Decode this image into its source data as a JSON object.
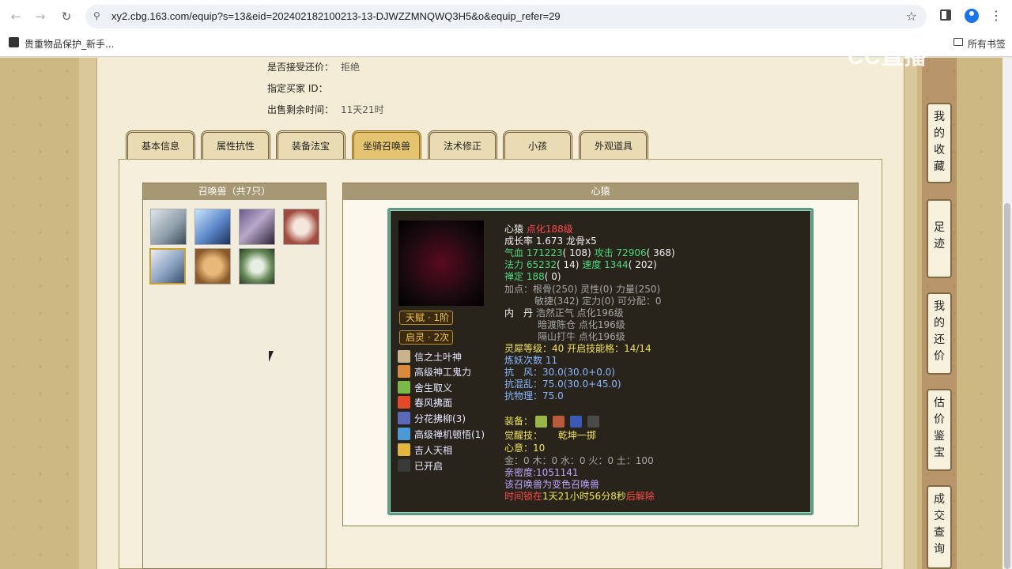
{
  "browser": {
    "url": "xy2.cbg.163.com/equip?s=13&eid=202402182100213-13-DJWZZMNQWQ3H5&o&equip_refer=29",
    "bookmark": "贵重物品保护_新手...",
    "all_bookmarks": "所有书签",
    "watermark": "CC直播"
  },
  "info": {
    "rows": [
      {
        "label": "是否接受还价：",
        "value": "拒绝"
      },
      {
        "label": "指定买家 ID：",
        "value": ""
      },
      {
        "label": "出售剩余时间：",
        "value": "11天21时"
      }
    ]
  },
  "tabs": [
    "基本信息",
    "属性抗性",
    "装备法宝",
    "坐骑召唤兽",
    "法术修正",
    "小孩",
    "外观道具"
  ],
  "active_tab": 3,
  "left_panel": {
    "title": "召唤兽（共7只）"
  },
  "right_panel": {
    "title": "心猿"
  },
  "pet": {
    "badges": [
      "天赋 · 1阶",
      "启灵 · 2次"
    ],
    "skills": [
      "信之土叶神",
      "高级神工鬼力",
      "舍生取义",
      "春风拂面",
      "分花拂柳(3)",
      "高级禅机顿悟(1)",
      "吉人天相",
      "已开启"
    ],
    "name": "心猿",
    "dianhua": "点化188级",
    "growth": "成长率 1.673 龙骨x5",
    "hp_label": "气血",
    "hp": "171223",
    "hp_extra": "( 108)",
    "atk_label": "攻击",
    "atk": "72906",
    "atk_extra": "( 368)",
    "mp_label": "法力",
    "mp": "65232",
    "mp_extra": "( 14)",
    "spd_label": "速度",
    "spd": "1344",
    "spd_extra": "( 202)",
    "shen_label": "禅定",
    "shen": "188",
    "shen_extra": "( 0)",
    "points1": "加点：根骨(250) 灵性(0) 力量(250)",
    "points2": "敏捷(342) 定力(0) 可分配：0",
    "neidan_label": "内　丹",
    "neidan1": "浩然正气 点化196级",
    "neidan2": "暗渡陈仓 点化196级",
    "neidan3": "隔山打牛 点化196级",
    "lingxi": "灵犀等级：40 开启技能格：14/14",
    "lianyao": "炼妖次数 11",
    "kangfeng_label": "抗　风：",
    "kangfeng": "30.0(30.0+0.0)",
    "kanghunluan_label": "抗混乱：",
    "kanghunluan": "75.0(30.0+45.0)",
    "kangwuli": "抗物理：75.0",
    "gear_label": "装备：",
    "awaken_label": "觉醒技：",
    "awaken": "乾坤一掷",
    "xinyi": "心意：10",
    "wuxing": "金：0 木：0 水：0 火：0 土：100",
    "qinmi": "亲密度:1051141",
    "note": "该召唤兽为变色召唤兽",
    "timer_pre": "时间锁在",
    "timer": "1天21小时56分8秒",
    "timer_post": "后解除"
  },
  "rail": [
    "我的收藏",
    "足迹",
    "我的还价",
    "估价鉴宝",
    "成交查询"
  ]
}
